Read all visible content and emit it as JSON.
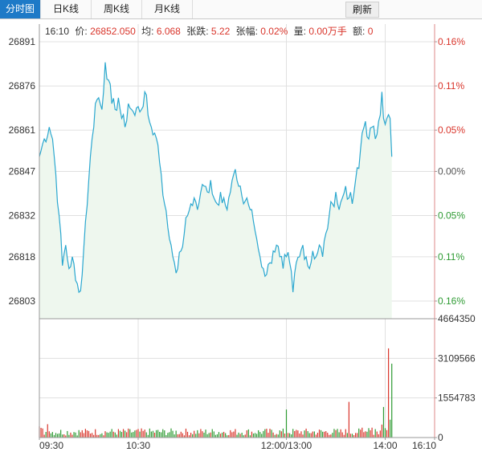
{
  "tabs": [
    {
      "label": "分时图",
      "active": true
    },
    {
      "label": "日K线",
      "active": false
    },
    {
      "label": "周K线",
      "active": false
    },
    {
      "label": "月K线",
      "active": false
    }
  ],
  "refresh_label": "刷新",
  "info": {
    "time": "16:10",
    "price_label": "价:",
    "price": "26852.050",
    "avg_label": "均:",
    "avg": "6.068",
    "change_label": "张跌:",
    "change": "5.22",
    "pct_label": "张幅:",
    "pct": "0.02%",
    "vol_label": "量:",
    "vol": "0.00万手",
    "amt_label": "额:",
    "amt": "0"
  },
  "colors": {
    "line": "#2aa7cf",
    "fill": "#eef7ee",
    "up": "#d9352b",
    "down": "#2e9b33",
    "neutral": "#555555",
    "grid": "#e0e0e0",
    "tab_active": "#1e7ac7"
  },
  "chart_data": [
    {
      "type": "area",
      "name": "price",
      "y_ticks": [
        "26891",
        "26876",
        "26861",
        "26847",
        "26832",
        "26818",
        "26803"
      ],
      "pct_ticks": [
        "0.16%",
        "0.11%",
        "0.05%",
        "0.00%",
        "0.05%",
        "0.11%",
        "0.16%"
      ],
      "pct_tick_colors": [
        "up",
        "up",
        "up",
        "neutral",
        "down",
        "down",
        "down"
      ],
      "ylim": [
        26797,
        26897
      ],
      "x_ticks": [
        "09:30",
        "10:30",
        "12:00/13:00",
        "14:00",
        "16:10"
      ],
      "x_tick_index": [
        0,
        60,
        150,
        210,
        240
      ],
      "x_count": 241,
      "key_points": [
        [
          0,
          26852
        ],
        [
          3,
          26858
        ],
        [
          6,
          26862
        ],
        [
          8,
          26858
        ],
        [
          10,
          26846
        ],
        [
          12,
          26832
        ],
        [
          14,
          26815
        ],
        [
          16,
          26822
        ],
        [
          18,
          26814
        ],
        [
          20,
          26818
        ],
        [
          22,
          26810
        ],
        [
          24,
          26806
        ],
        [
          26,
          26812
        ],
        [
          28,
          26830
        ],
        [
          30,
          26844
        ],
        [
          32,
          26858
        ],
        [
          34,
          26870
        ],
        [
          36,
          26872
        ],
        [
          38,
          26868
        ],
        [
          40,
          26884
        ],
        [
          42,
          26878
        ],
        [
          44,
          26870
        ],
        [
          46,
          26868
        ],
        [
          48,
          26872
        ],
        [
          50,
          26865
        ],
        [
          52,
          26862
        ],
        [
          54,
          26870
        ],
        [
          56,
          26868
        ],
        [
          58,
          26866
        ],
        [
          60,
          26869
        ],
        [
          62,
          26868
        ],
        [
          64,
          26874
        ],
        [
          66,
          26866
        ],
        [
          68,
          26862
        ],
        [
          70,
          26860
        ],
        [
          72,
          26856
        ],
        [
          74,
          26846
        ],
        [
          76,
          26836
        ],
        [
          78,
          26828
        ],
        [
          80,
          26822
        ],
        [
          82,
          26816
        ],
        [
          84,
          26814
        ],
        [
          86,
          26820
        ],
        [
          88,
          26826
        ],
        [
          90,
          26832
        ],
        [
          92,
          26836
        ],
        [
          94,
          26838
        ],
        [
          96,
          26834
        ],
        [
          98,
          26840
        ],
        [
          100,
          26842
        ],
        [
          102,
          26840
        ],
        [
          104,
          26844
        ],
        [
          106,
          26838
        ],
        [
          108,
          26836
        ],
        [
          110,
          26840
        ],
        [
          112,
          26838
        ],
        [
          114,
          26834
        ],
        [
          116,
          26840
        ],
        [
          118,
          26846
        ],
        [
          120,
          26844
        ],
        [
          122,
          26842
        ],
        [
          124,
          26836
        ],
        [
          126,
          26838
        ],
        [
          128,
          26834
        ],
        [
          130,
          26830
        ],
        [
          132,
          26824
        ],
        [
          134,
          26818
        ],
        [
          136,
          26814
        ],
        [
          138,
          26812
        ],
        [
          140,
          26816
        ],
        [
          142,
          26820
        ],
        [
          144,
          26822
        ],
        [
          146,
          26818
        ],
        [
          148,
          26814
        ],
        [
          150,
          26818
        ],
        [
          152,
          26816
        ],
        [
          154,
          26806
        ],
        [
          156,
          26816
        ],
        [
          158,
          26818
        ],
        [
          160,
          26822
        ],
        [
          162,
          26818
        ],
        [
          164,
          26814
        ],
        [
          166,
          26820
        ],
        [
          168,
          26818
        ],
        [
          170,
          26822
        ],
        [
          172,
          26818
        ],
        [
          174,
          26826
        ],
        [
          176,
          26832
        ],
        [
          178,
          26836
        ],
        [
          180,
          26840
        ],
        [
          182,
          26834
        ],
        [
          184,
          26838
        ],
        [
          186,
          26842
        ],
        [
          188,
          26838
        ],
        [
          190,
          26836
        ],
        [
          192,
          26844
        ],
        [
          194,
          26848
        ],
        [
          196,
          26860
        ],
        [
          198,
          26864
        ],
        [
          200,
          26858
        ],
        [
          202,
          26862
        ],
        [
          204,
          26858
        ],
        [
          206,
          26864
        ],
        [
          208,
          26874
        ],
        [
          209,
          26865
        ],
        [
          211,
          26865
        ],
        [
          213,
          26865
        ],
        [
          214,
          26852
        ]
      ],
      "volume": {
        "y_ticks": [
          "4664350",
          "3109566",
          "1554783",
          "0"
        ],
        "ylim": [
          0,
          4664350
        ],
        "spikes": [
          [
            150,
            1100000
          ],
          [
            188,
            1400000
          ],
          [
            209,
            1200000
          ],
          [
            212,
            3500000
          ],
          [
            213,
            700000
          ],
          [
            214,
            2900000
          ]
        ]
      }
    }
  ]
}
